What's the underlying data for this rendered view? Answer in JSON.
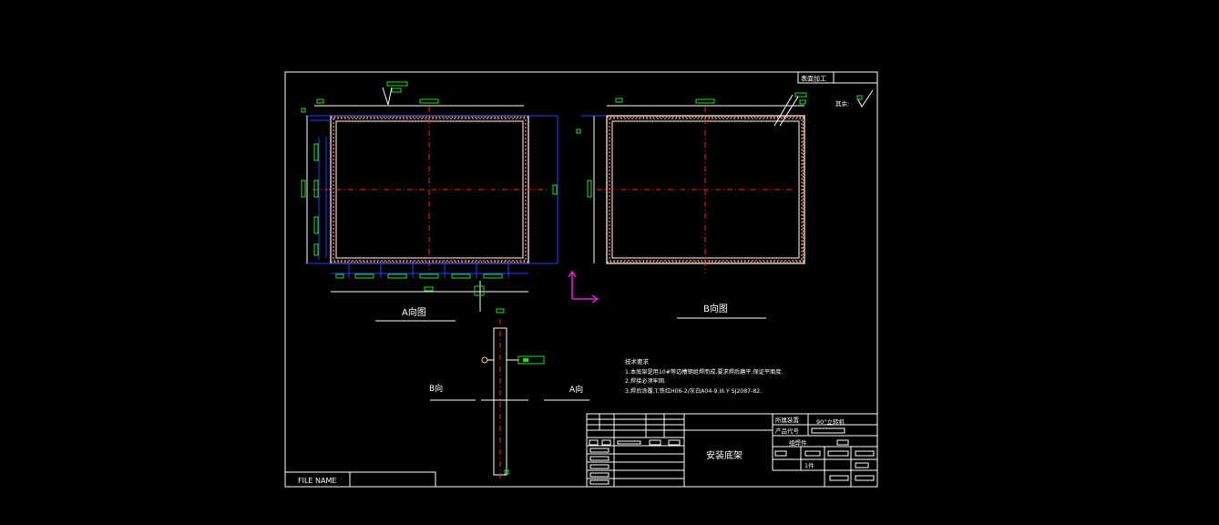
{
  "colors": {
    "background": "#000000",
    "border": "#ffffff",
    "frame_outer": "#ffffff",
    "frame_inner_dash": "#ff3030",
    "weld_dots": "#ffd24a",
    "dimension_lines": "#2040ff",
    "annotation_green": "#20e020",
    "center_lines": "#ff2020",
    "axis_icon": "#e020e0"
  },
  "views": {
    "view_a_label": "A向图",
    "view_b_label": "B向图",
    "side_label_b": "B向",
    "side_label_a": "A向"
  },
  "surface_finish": {
    "header": "表面加工",
    "remark": "其余:"
  },
  "tech_requirements": {
    "title": "技术要求",
    "line1": "1.本底架是用10#等边槽钢组焊而成,要求焊后磨平,保证平面度.",
    "line2": "2.焊接必须牢固.",
    "line3": "3.焊后涂覆.T.铁红H06-2/灰白A04-9.III.Y  SJ2087-82."
  },
  "title_block": {
    "drawing_name": "安装底架",
    "belongs_label": "所属装置",
    "belongs_value": "90°立转机",
    "product_code_label": "产品代号",
    "product_code_value": "",
    "part_type": "组焊件",
    "quantity": "1件"
  },
  "file_name": {
    "label": "FILE NAME",
    "value": ""
  }
}
